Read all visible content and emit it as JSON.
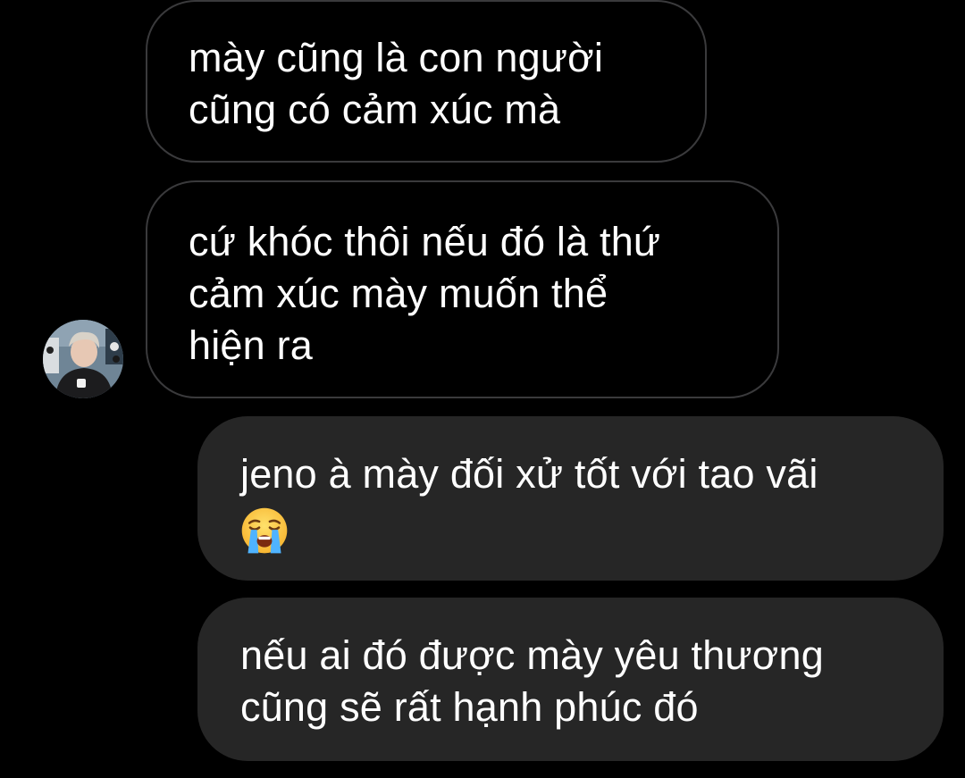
{
  "messages": [
    {
      "direction": "incoming",
      "lines": [
        "mày cũng là con người",
        "cũng có cảm xúc mà"
      ]
    },
    {
      "direction": "incoming",
      "lines": [
        "cứ khóc thôi nếu đó là thứ",
        "cảm xúc mày muốn thể",
        "hiện ra"
      ]
    },
    {
      "direction": "outgoing",
      "lines": [
        "jeno à mày đối xử tốt với tao vãi"
      ],
      "emoji": "loudly-crying-face-icon"
    },
    {
      "direction": "outgoing",
      "lines": [
        "nếu ai đó được mày yêu thương",
        "cũng sẽ rất hạnh phúc đó"
      ]
    }
  ],
  "avatar": {
    "icon": "contact-avatar"
  },
  "colors": {
    "background": "#000000",
    "incoming_border": "#3a3a3c",
    "outgoing_bubble": "#262626",
    "text": "#ffffff"
  }
}
